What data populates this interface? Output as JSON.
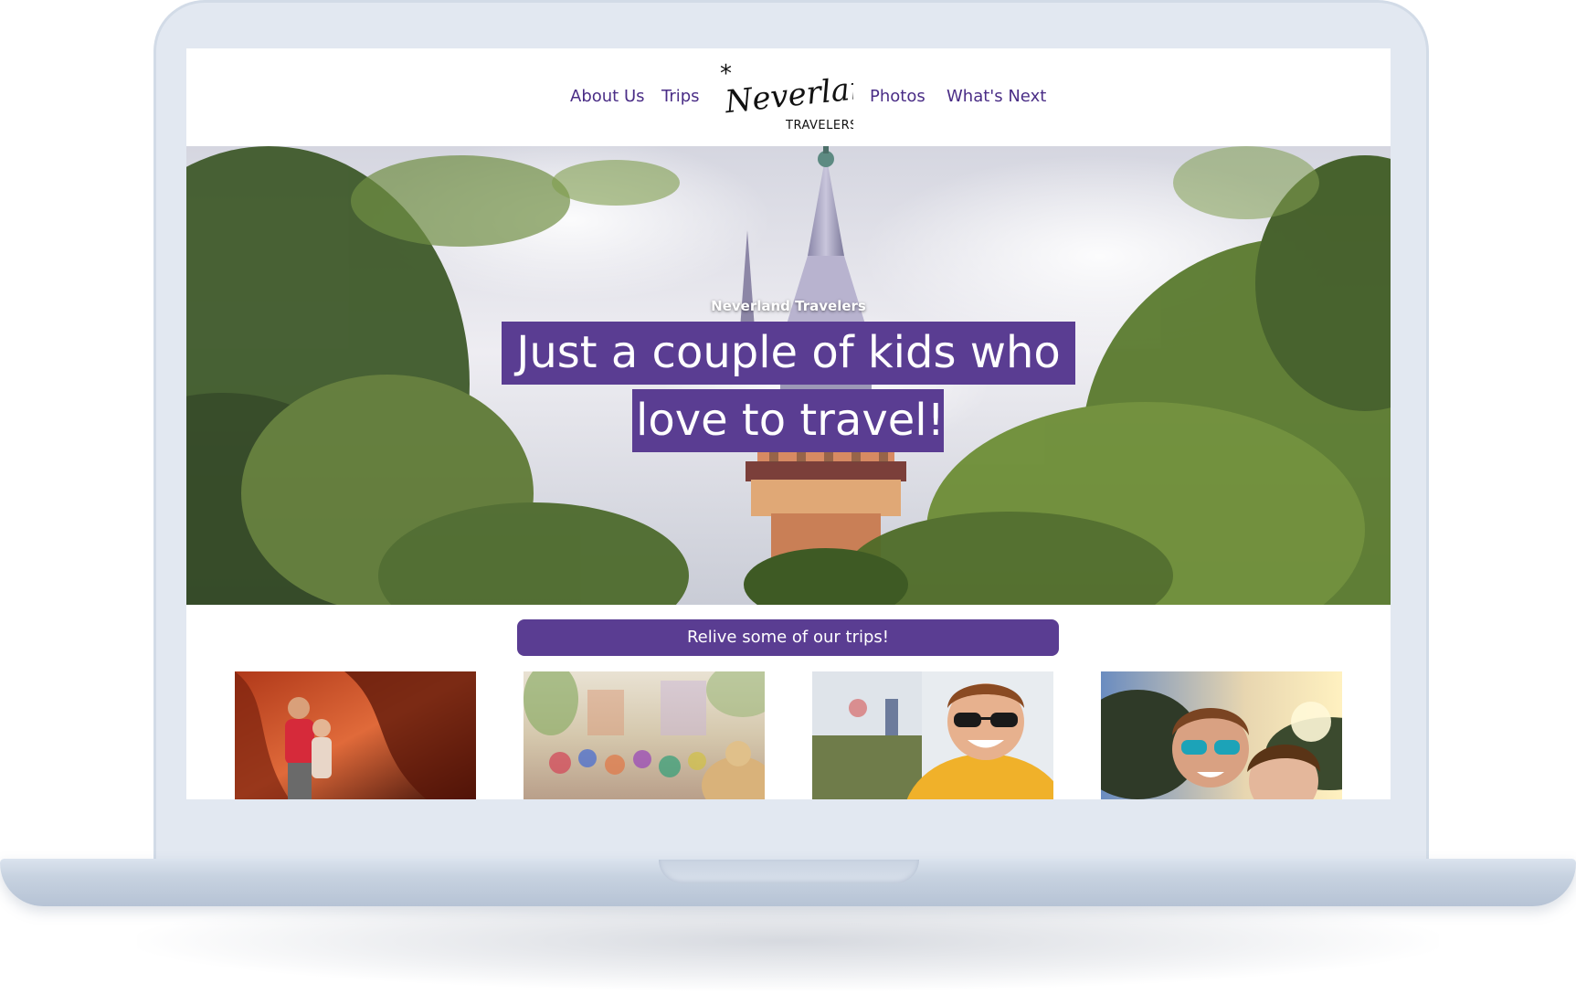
{
  "nav": {
    "left_links": [
      {
        "label": "About Us"
      },
      {
        "label": "Trips"
      }
    ],
    "right_links": [
      {
        "label": "Photos"
      },
      {
        "label": "What's Next"
      }
    ],
    "logo": {
      "main": "Neverland",
      "sub": "TRAVELERS",
      "mark": "*"
    },
    "link_color": "#4a2d86"
  },
  "hero": {
    "kicker": "Neverland Travelers",
    "headline_line1": "Just a couple of kids who",
    "headline_line2": "love to travel!",
    "highlight_color": "#5a3d92"
  },
  "trips": {
    "banner_label": "Relive some of our trips!",
    "thumbnails": [
      {
        "icon": "canyon-couple-photo"
      },
      {
        "icon": "theme-park-crowd-photo"
      },
      {
        "icon": "sunglasses-selfie-photo"
      },
      {
        "icon": "sunset-selfie-photo"
      }
    ]
  },
  "device": {
    "frame_color": "#e2e8f1"
  }
}
